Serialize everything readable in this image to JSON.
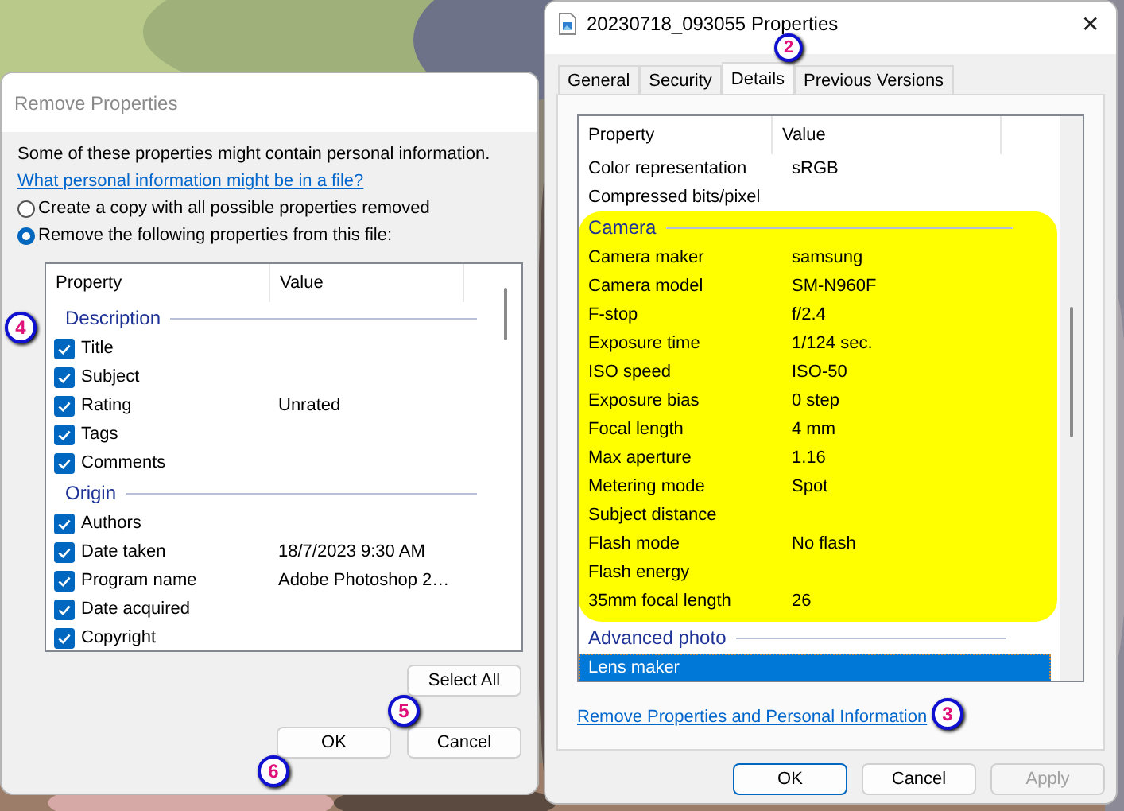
{
  "remove_dialog": {
    "title": "Remove Properties",
    "intro": "Some of these properties might contain personal information.",
    "help_link": "What personal information might be in a file?",
    "options": [
      {
        "label": "Create a copy with all possible properties removed",
        "selected": false
      },
      {
        "label": "Remove the following properties from this file:",
        "selected": true
      }
    ],
    "table": {
      "columns": [
        "Property",
        "Value"
      ],
      "groups": [
        {
          "name": "Description",
          "rows": [
            {
              "property": "Title",
              "checked": true
            },
            {
              "property": "Subject",
              "checked": true
            },
            {
              "property": "Rating",
              "value": "Unrated",
              "checked": true
            },
            {
              "property": "Tags",
              "checked": true
            },
            {
              "property": "Comments",
              "checked": true
            }
          ]
        },
        {
          "name": "Origin",
          "rows": [
            {
              "property": "Authors",
              "checked": true
            },
            {
              "property": "Date taken",
              "value": "18/7/2023 9:30 AM",
              "checked": true
            },
            {
              "property": "Program name",
              "value": "Adobe Photoshop 2…",
              "checked": true
            },
            {
              "property": "Date acquired",
              "checked": true
            },
            {
              "property": "Copyright",
              "checked": true
            }
          ]
        }
      ]
    },
    "select_all": "Select All",
    "buttons": [
      "OK",
      "Cancel"
    ]
  },
  "properties_dialog": {
    "title": "20230718_093055 Properties",
    "close": "✕",
    "tabs": [
      {
        "label": "General",
        "selected": false
      },
      {
        "label": "Security",
        "selected": false
      },
      {
        "label": "Details",
        "selected": true
      },
      {
        "label": "Previous Versions",
        "selected": false
      }
    ],
    "table": {
      "columns": [
        "Property",
        "Value"
      ],
      "rows": [
        {
          "property": "Color representation",
          "value": "sRGB",
          "selected": false
        },
        {
          "property": "Compressed bits/pixel",
          "selected": false
        }
      ],
      "groups": [
        {
          "name": "Camera",
          "highlighted": true,
          "rows": [
            {
              "property": "Camera maker",
              "value": "samsung",
              "selected": false
            },
            {
              "property": "Camera model",
              "value": "SM-N960F",
              "selected": false
            },
            {
              "property": "F-stop",
              "value": "f/2.4",
              "selected": false
            },
            {
              "property": "Exposure time",
              "value": "1/124 sec.",
              "selected": false
            },
            {
              "property": "ISO speed",
              "value": "ISO-50",
              "selected": false
            },
            {
              "property": "Exposure bias",
              "value": "0 step",
              "selected": false
            },
            {
              "property": "Focal length",
              "value": "4 mm",
              "selected": false
            },
            {
              "property": "Max aperture",
              "value": "1.16",
              "selected": false
            },
            {
              "property": "Metering mode",
              "value": "Spot",
              "selected": false
            },
            {
              "property": "Subject distance",
              "selected": false
            },
            {
              "property": "Flash mode",
              "value": "No flash",
              "selected": false
            },
            {
              "property": "Flash energy",
              "selected": false
            },
            {
              "property": "35mm focal length",
              "value": "26",
              "selected": false
            }
          ]
        },
        {
          "name": "Advanced photo",
          "highlighted": false,
          "rows": [
            {
              "property": "Lens maker",
              "selected": true
            }
          ]
        }
      ]
    },
    "remove_link": "Remove Properties and Personal Information",
    "buttons": [
      {
        "label": "OK",
        "disabled": false
      },
      {
        "label": "Cancel",
        "disabled": false
      },
      {
        "label": "Apply",
        "disabled": true
      }
    ]
  },
  "annotations": [
    {
      "number": "2"
    },
    {
      "number": "3"
    },
    {
      "number": "4"
    },
    {
      "number": "5"
    },
    {
      "number": "6"
    }
  ]
}
